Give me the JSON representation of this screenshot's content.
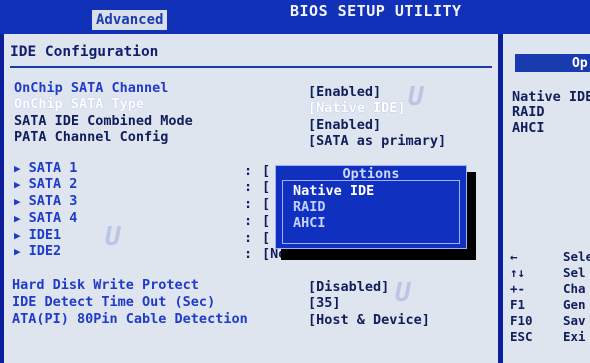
{
  "top_bar": {
    "active_tab": "Advanced",
    "title": "BIOS SETUP UTILITY"
  },
  "main": {
    "header": "IDE Configuration",
    "settings": [
      {
        "label": "OnChip SATA Channel",
        "value": "[Enabled]",
        "style": "blue"
      },
      {
        "label": "OnChip SATA Type",
        "value": "[Native IDE]",
        "style": "white"
      },
      {
        "label": "SATA IDE Combined Mode",
        "value": "[Enabled]",
        "style": "dark"
      },
      {
        "label": "PATA Channel Config",
        "value": "[SATA as primary]",
        "style": "dark"
      }
    ],
    "devices": [
      {
        "label": "SATA 1",
        "colon": ":",
        "value": "["
      },
      {
        "label": "SATA 2",
        "colon": ":",
        "value": "["
      },
      {
        "label": "SATA 3",
        "colon": ":",
        "value": "["
      },
      {
        "label": "SATA 4",
        "colon": ":",
        "value": "["
      },
      {
        "label": "IDE1",
        "colon": ":",
        "value": "["
      },
      {
        "label": "IDE2",
        "colon": ":",
        "value": "[Not Detected]"
      }
    ],
    "bottom_settings": [
      {
        "label": "Hard Disk Write Protect",
        "value": "[Disabled]"
      },
      {
        "label": "IDE Detect Time Out (Sec)",
        "value": "[35]"
      },
      {
        "label": "ATA(PI) 80Pin Cable Detection",
        "value": "[Host & Device]"
      }
    ]
  },
  "popup": {
    "title": "Options",
    "options": [
      "Native IDE",
      "RAID",
      "AHCI"
    ],
    "selected": "Native IDE"
  },
  "help_panel": {
    "header_partial": "Op",
    "lines": [
      "Native IDE",
      "RAID",
      "AHCI"
    ],
    "keys": [
      {
        "key": "←",
        "desc": "Sele"
      },
      {
        "key": "↑↓",
        "desc": "Sel"
      },
      {
        "key": "+-",
        "desc": "Cha"
      },
      {
        "key": "F1",
        "desc": "Gen"
      },
      {
        "key": "F10",
        "desc": "Sav"
      },
      {
        "key": "ESC",
        "desc": "Exi"
      }
    ]
  },
  "colors": {
    "background": "#0b1f9c",
    "panel": "#dfe5ee",
    "highlight_text": "#ffffff",
    "accent_blue": "#1f3bc9"
  }
}
